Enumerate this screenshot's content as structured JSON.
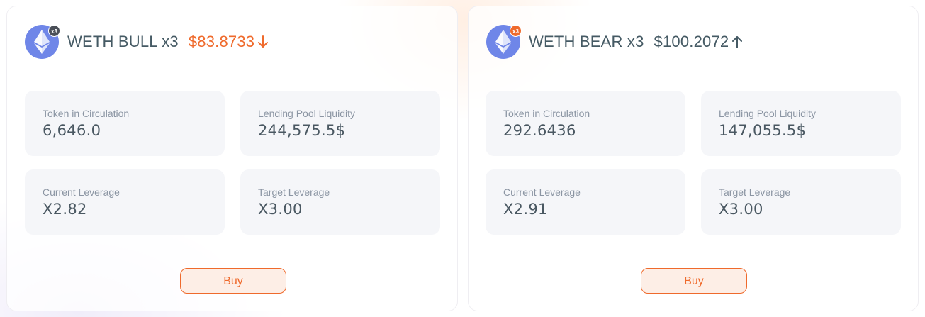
{
  "cards": [
    {
      "name": "WETH BULL x3",
      "badge": "x3",
      "price": "$83.8733",
      "price_direction": "down",
      "stats": [
        {
          "label": "Token in Circulation",
          "value": "6,646.0"
        },
        {
          "label": "Lending Pool Liquidity",
          "value": "244,575.5$"
        },
        {
          "label": "Current Leverage",
          "value": "X2.82"
        },
        {
          "label": "Target Leverage",
          "value": "X3.00"
        }
      ],
      "buy_label": "Buy"
    },
    {
      "name": "WETH BEAR x3",
      "badge": "x3",
      "price": "$100.2072",
      "price_direction": "up",
      "stats": [
        {
          "label": "Token in Circulation",
          "value": "292.6436"
        },
        {
          "label": "Lending Pool Liquidity",
          "value": "147,055.5$"
        },
        {
          "label": "Current Leverage",
          "value": "X2.91"
        },
        {
          "label": "Target Leverage",
          "value": "X3.00"
        }
      ],
      "buy_label": "Buy"
    }
  ],
  "colors": {
    "accent": "#ef6a2c",
    "text": "#455a64",
    "eth_icon": "#6f86e8",
    "stat_bg": "#f5f6f9"
  },
  "icons": {
    "token": "ethereum-icon",
    "down": "arrow-down-icon",
    "up": "arrow-up-icon"
  }
}
